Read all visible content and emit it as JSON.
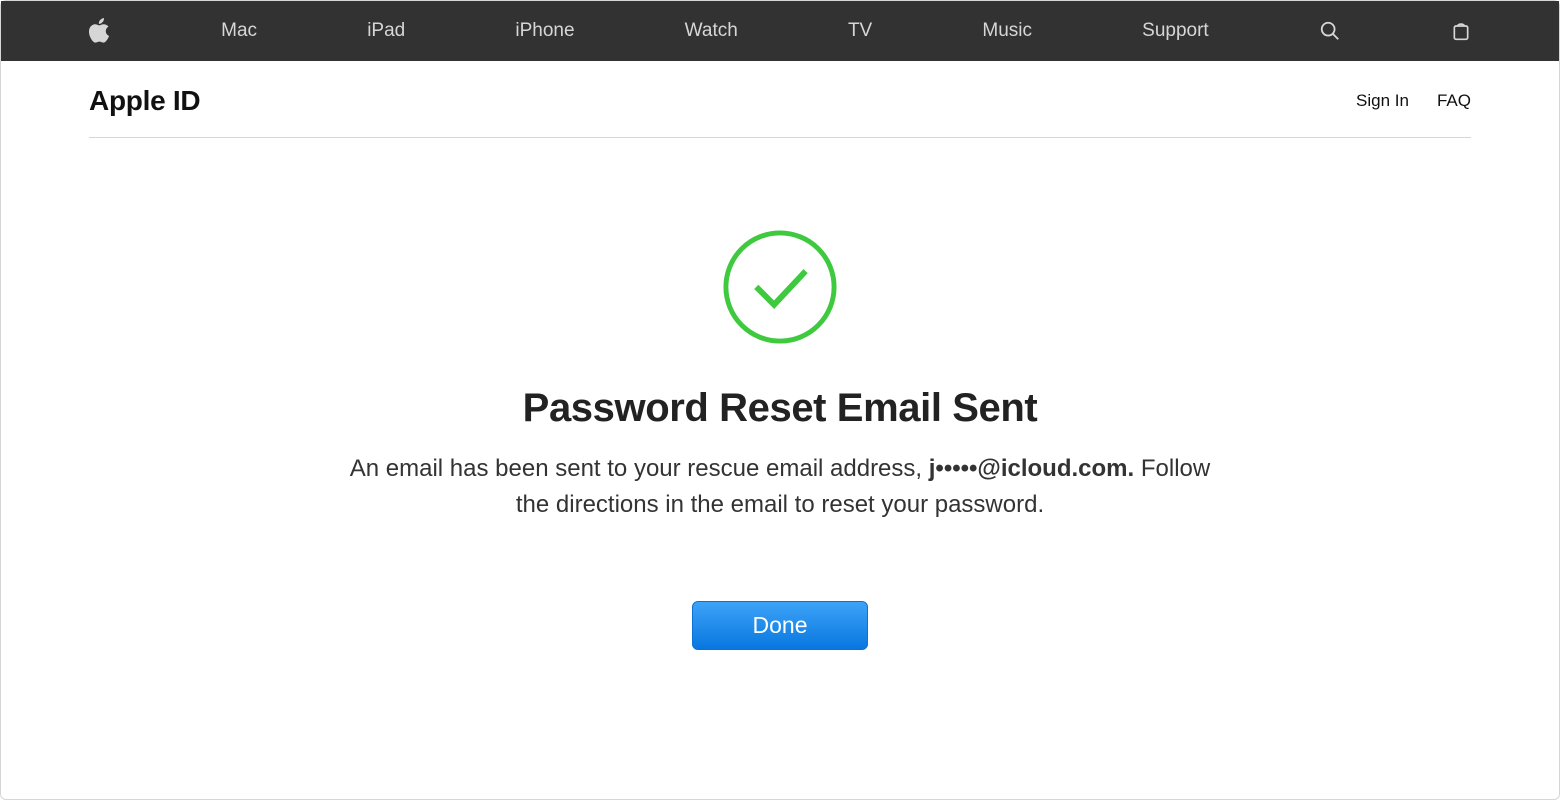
{
  "globalNav": {
    "items": [
      "Mac",
      "iPad",
      "iPhone",
      "Watch",
      "TV",
      "Music",
      "Support"
    ]
  },
  "subHeader": {
    "title": "Apple ID",
    "links": [
      "Sign In",
      "FAQ"
    ]
  },
  "main": {
    "heading": "Password Reset Email Sent",
    "bodyPrefix": "An email has been sent to your rescue email address, ",
    "email": "j•••••@icloud.com.",
    "bodySuffix": " Follow the directions in the email to reset your password.",
    "doneLabel": "Done"
  },
  "colors": {
    "navBg": "#323232",
    "successGreen": "#3ec93e",
    "buttonBlue": "#1a8ef0"
  }
}
